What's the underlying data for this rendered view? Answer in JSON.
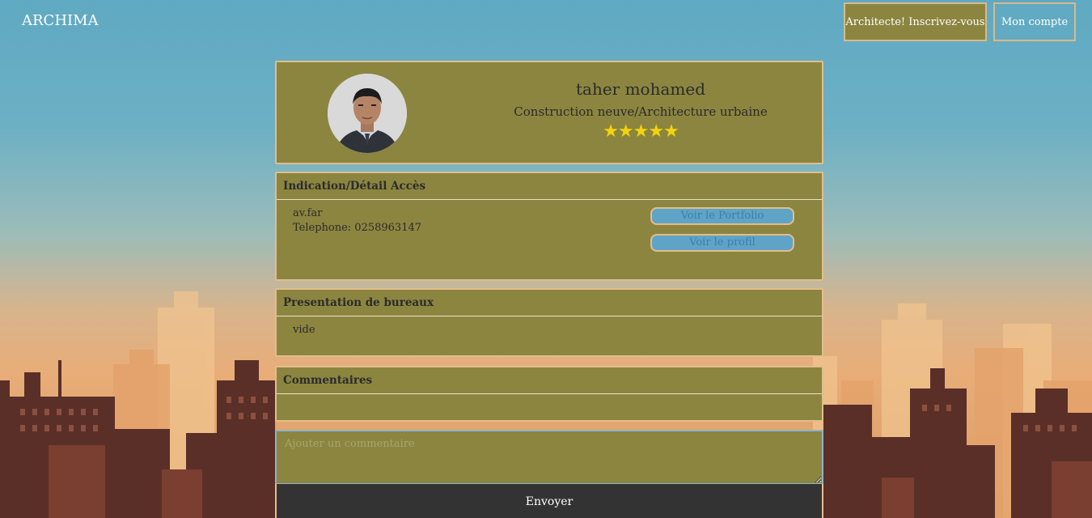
{
  "header": {
    "brand": "ARCHIMA",
    "register_label": "Architecte! Inscrivez-vous",
    "account_label": "Mon compte"
  },
  "profile": {
    "name": "taher mohamed",
    "specialty": "Construction neuve/Architecture urbaine",
    "rating_stars": "★★★★★",
    "rating_value": 5,
    "rating_max": 5
  },
  "access": {
    "title": "Indication/Détail Accès",
    "address": "av.far",
    "phone": "Telephone: 0258963147",
    "portfolio_label": "Voir le Portfolio",
    "profile_label": "Voir le profil"
  },
  "office": {
    "title": "Presentation de bureaux",
    "content": "vide"
  },
  "comments": {
    "title": "Commentaires",
    "input_placeholder": "Ajouter un commentaire",
    "send_label": "Envoyer"
  },
  "colors": {
    "panel_bg": "#8b8540",
    "panel_border": "#e2bd8c",
    "link_button_bg": "#5fa4c7",
    "send_button_bg": "#333333",
    "star": "#f5d20c"
  }
}
